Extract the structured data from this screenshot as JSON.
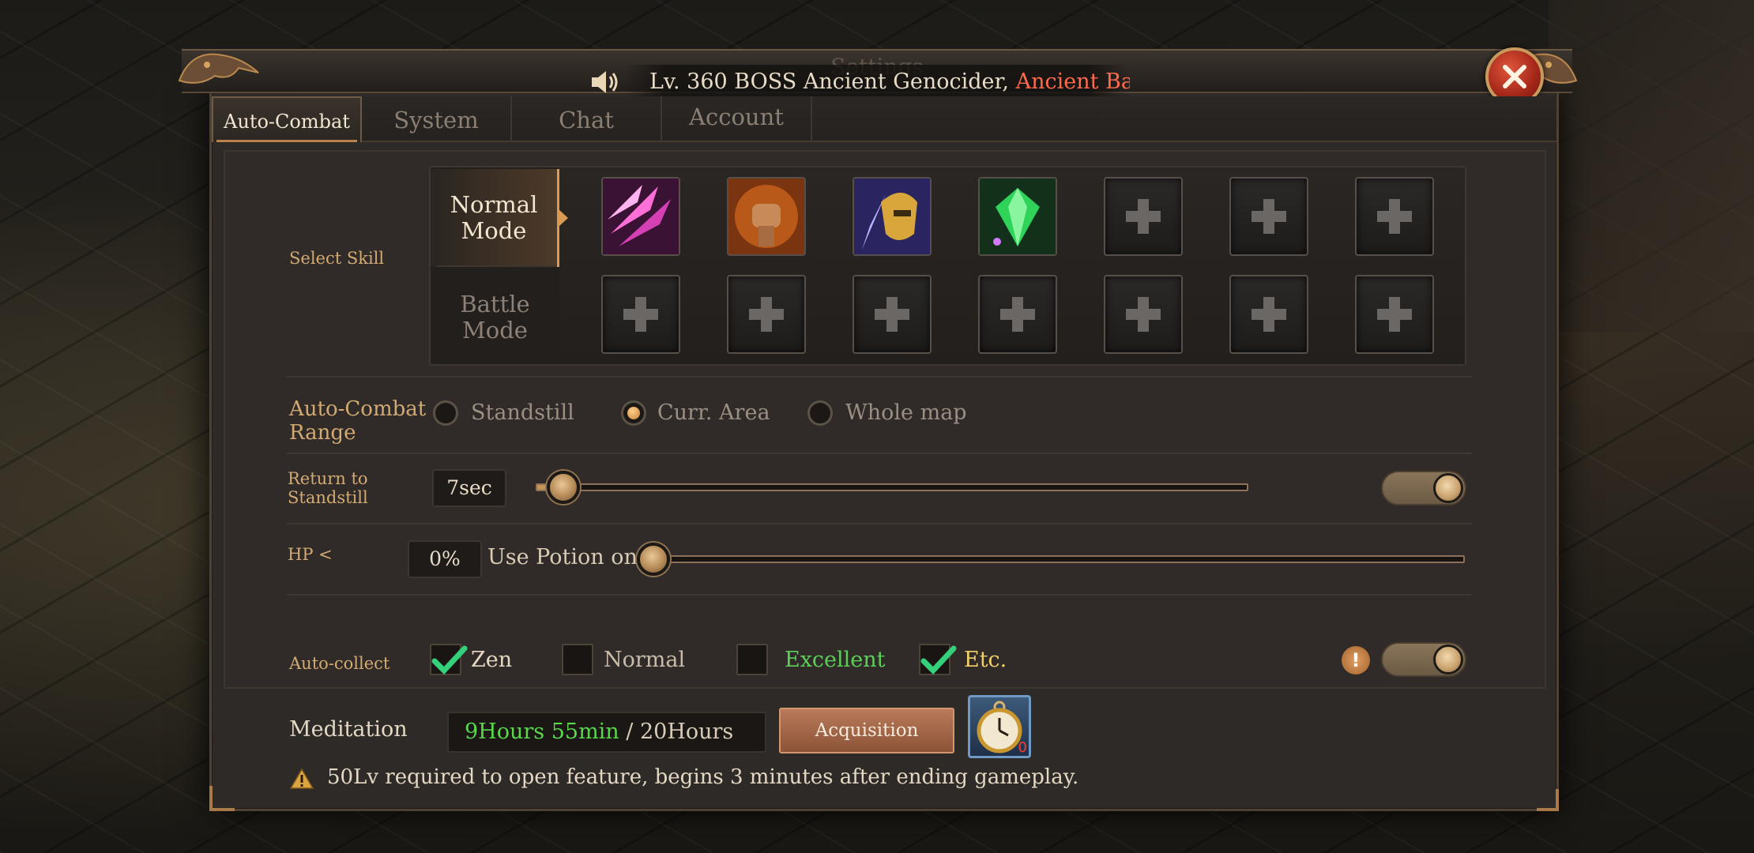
{
  "header": {
    "title": "Settings",
    "ticker_prefix": "Lv. 360 BOSS Ancient Genocider,",
    "ticker_highlight": " Ancient Battle"
  },
  "tabs": [
    {
      "label": "Auto-Combat",
      "active": true
    },
    {
      "label": "System",
      "active": false
    },
    {
      "label": "Chat",
      "active": false
    },
    {
      "label": "Account",
      "active": false
    }
  ],
  "auto_combat": {
    "select_skill_label": "Select Skill",
    "modes": [
      "Normal\nMode",
      "Battle\nMode"
    ],
    "normal_mode_label": "Normal Mode",
    "battle_mode_label": "Battle Mode",
    "normal_skills": [
      "pink-blades-skill-icon",
      "fist-skill-icon",
      "golden-knight-skill-icon",
      "green-gem-skill-icon",
      "empty",
      "empty",
      "empty"
    ],
    "battle_skills": [
      "empty",
      "empty",
      "empty",
      "empty",
      "empty",
      "empty",
      "empty"
    ],
    "range_label": "Auto-Combat Range",
    "range_options": [
      "Standstill",
      "Curr. Area",
      "Whole map"
    ],
    "range_selected": "Curr. Area",
    "return_label": "Return to Standstill",
    "return_value": "7sec",
    "return_slider_level": 0.02,
    "return_toggle_on": true,
    "hp_label": "HP <",
    "hp_value": "0%",
    "potion_label": "Use Potion on",
    "hp_slider_level": 0.0,
    "collect_label": "Auto-collect",
    "collect_options": [
      {
        "label": "Zen",
        "checked": true,
        "color": "#e4d8c4"
      },
      {
        "label": "Normal",
        "checked": false,
        "color": "#c9bdaa"
      },
      {
        "label": "Excellent",
        "checked": false,
        "color": "#5ccf5a"
      },
      {
        "label": "Etc.",
        "checked": true,
        "color": "#f0d068"
      }
    ],
    "collect_toggle_on": true,
    "info_badge": "!"
  },
  "meditation": {
    "label": "Meditation",
    "current": "9Hours 55min",
    "separator": " / ",
    "max": "20Hours",
    "button": "Acquisition",
    "watch_count": "0",
    "warning": "50Lv required to open feature, begins 3 minutes after ending gameplay."
  },
  "colors": {
    "accent_gold": "#d2aa72",
    "close_red": "#a8291a",
    "green_time": "#58d84a",
    "ticker_red": "#ff6a4a"
  }
}
